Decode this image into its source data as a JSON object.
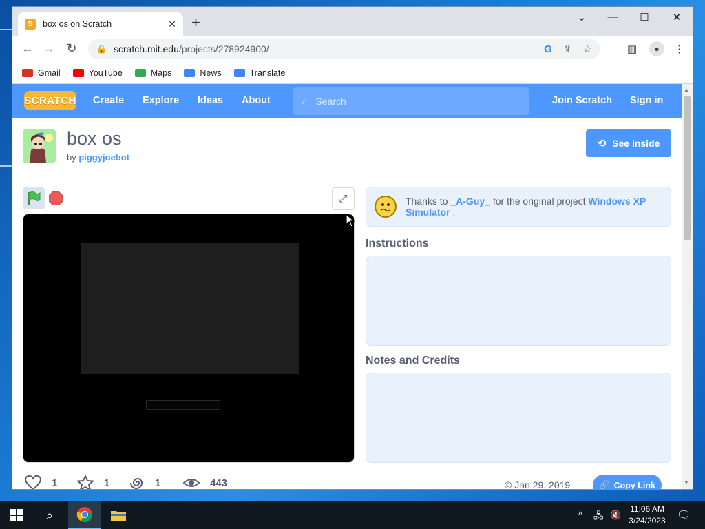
{
  "browser": {
    "tab_title": "box os on Scratch",
    "url_host": "scratch.mit.edu",
    "url_path": "/projects/278924900/",
    "bookmarks": [
      {
        "label": "Gmail",
        "icon": "gmail-icon",
        "color": "#d93025"
      },
      {
        "label": "YouTube",
        "icon": "youtube-icon",
        "color": "#ff0000"
      },
      {
        "label": "Maps",
        "icon": "maps-icon",
        "color": "#34a853"
      },
      {
        "label": "News",
        "icon": "news-icon",
        "color": "#4285f4"
      },
      {
        "label": "Translate",
        "icon": "translate-icon",
        "color": "#4285f4"
      }
    ]
  },
  "scratch": {
    "logo": "SCRATCH",
    "nav": {
      "create": "Create",
      "explore": "Explore",
      "ideas": "Ideas",
      "about": "About",
      "search_placeholder": "Search",
      "join": "Join Scratch",
      "signin": "Sign in"
    },
    "project": {
      "title": "box os",
      "by_prefix": "by",
      "author": "piggyjoebot",
      "see_inside": "See inside",
      "thanks_prefix": "Thanks to",
      "thanks_user": "_A-Guy_",
      "thanks_middle": "for the original project",
      "original_project": "Windows XP Simulator",
      "thanks_suffix": ".",
      "instructions_label": "Instructions",
      "notes_label": "Notes and Credits",
      "loves": "1",
      "favorites": "1",
      "remixes": "1",
      "views": "443",
      "date": "Jan 29, 2019",
      "copy_link": "Copy Link"
    }
  },
  "taskbar": {
    "time": "11:06 AM",
    "date": "3/24/2023"
  },
  "colors": {
    "scratch_blue": "#4d97ff",
    "scratch_text": "#575e75",
    "stage_bg": "#000000"
  }
}
